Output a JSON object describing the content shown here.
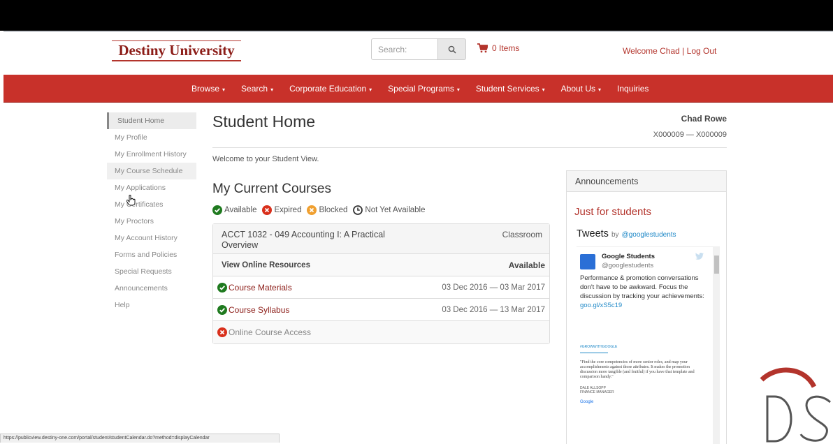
{
  "header": {
    "logo": "Destiny University",
    "search_placeholder": "Search:",
    "cart_label": "0 Items",
    "welcome": "Welcome Chad",
    "separator": "|",
    "logout": "Log Out"
  },
  "nav": {
    "items": [
      {
        "label": "Browse",
        "caret": "▾"
      },
      {
        "label": "Search",
        "caret": "▾"
      },
      {
        "label": "Corporate Education",
        "caret": "▾"
      },
      {
        "label": "Special Programs",
        "caret": "▾"
      },
      {
        "label": "Student Services",
        "caret": "▾"
      },
      {
        "label": "About Us",
        "caret": "▾"
      },
      {
        "label": "Inquiries",
        "caret": ""
      }
    ]
  },
  "sidebar": {
    "items": [
      {
        "label": "Student Home"
      },
      {
        "label": "My Profile"
      },
      {
        "label": "My Enrollment History"
      },
      {
        "label": "My Course Schedule"
      },
      {
        "label": "My Applications"
      },
      {
        "label": "My Certificates"
      },
      {
        "label": "My Proctors"
      },
      {
        "label": "My Account History"
      },
      {
        "label": "Forms and Policies"
      },
      {
        "label": "Special Requests"
      },
      {
        "label": "Announcements"
      },
      {
        "label": "Help"
      }
    ]
  },
  "main": {
    "title": "Student Home",
    "user_name": "Chad Rowe",
    "user_id": "X000009 — X000009",
    "welcome": "Welcome to your Student View.",
    "courses_title": "My Current Courses",
    "legend": [
      {
        "label": "Available",
        "color": "#1f7a1f"
      },
      {
        "label": "Expired",
        "color": "#d9301c"
      },
      {
        "label": "Blocked",
        "color": "#f0a030"
      },
      {
        "label": "Not Yet Available",
        "color": "#333333"
      }
    ],
    "course": {
      "name": "ACCT 1032 - 049 Accounting I: A Practical Overview",
      "type": "Classroom",
      "resources_header": "View Online Resources",
      "availability_header": "Available",
      "resources": [
        {
          "label": "Course Materials",
          "dates": "03 Dec 2016 — 03 Mar 2017",
          "status": "available"
        },
        {
          "label": "Course Syllabus",
          "dates": "03 Dec 2016 — 13 Mar 2017",
          "status": "available"
        },
        {
          "label": "Online Course Access",
          "dates": "",
          "status": "expired"
        }
      ]
    }
  },
  "announcements": {
    "header": "Announcements",
    "subtitle": "Just for students",
    "tweets_title": "Tweets",
    "tweets_by": "by",
    "tweets_handle": "@googlestudents",
    "tweet": {
      "name": "Google Students",
      "handle": "@googlestudents",
      "text": "Performance & promotion conversations don't have to be awkward. Focus the discussion by tracking your achievements:",
      "link": "goo.gl/xS5c19",
      "card_tag": "#GROWWITHGOOGLE",
      "card_quote": "\"Find the core competencies of more senior roles, and map your accomplishments against those attributes. It makes the promotion discussion more tangible (and fruitful) if you have that template and comparison handy.\"",
      "card_author": "DALE ALLSOPP",
      "card_role": "FINANCE MANAGER",
      "card_logo": "Google"
    }
  },
  "statusbar": {
    "url": "https://publicview.destiny-one.com/portal/student/studentCalendar.do?method=displayCalendar"
  },
  "colors": {
    "brand_red": "#c8312a",
    "link_red": "#8c1d18",
    "available_green": "#1f7a1f",
    "expired_red": "#d9301c"
  }
}
